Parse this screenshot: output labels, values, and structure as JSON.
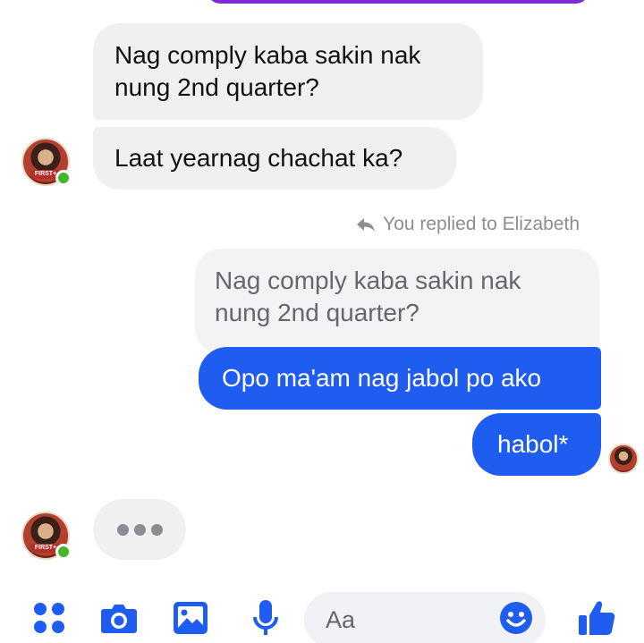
{
  "messages": {
    "incoming_1": "Nag comply kaba sakin nak\nnung 2nd quarter?",
    "incoming_2": "Laat yearnag chachat ka?",
    "reply_note": "You replied to Elizabeth",
    "quoted": "Nag comply kaba sakin nak\nnung 2nd quarter?",
    "outgoing_1": "Opo ma'am nag jabol po ako",
    "outgoing_2": "habol*"
  },
  "avatar": {
    "tag_text": "FIRST+"
  },
  "composer": {
    "placeholder": "Aa"
  },
  "colors": {
    "messenger_blue": "#1f5cf0",
    "incoming_bubble": "#f1f0f0",
    "online_green": "#42b72a",
    "icon_blue": "#1f5cf0"
  },
  "icons": [
    "menu-dots-icon",
    "camera-icon",
    "image-icon",
    "microphone-icon",
    "emoji-icon",
    "thumbs-up-icon",
    "reply-arrow-icon"
  ]
}
